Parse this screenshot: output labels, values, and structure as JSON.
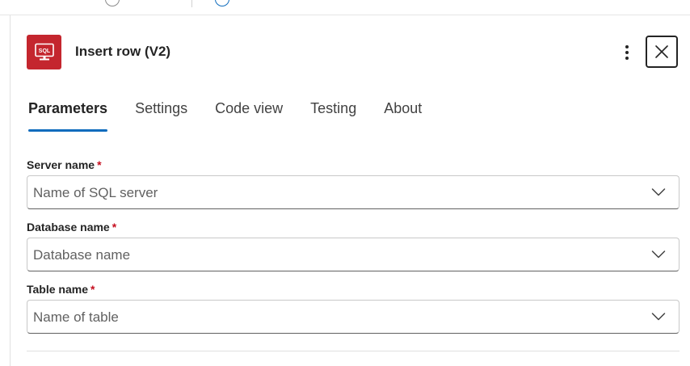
{
  "header": {
    "title": "Insert row (V2)",
    "icon_label": "SQL",
    "icon_color": "#c4262e"
  },
  "tabs": [
    {
      "label": "Parameters",
      "active": true
    },
    {
      "label": "Settings",
      "active": false
    },
    {
      "label": "Code view",
      "active": false
    },
    {
      "label": "Testing",
      "active": false
    },
    {
      "label": "About",
      "active": false
    }
  ],
  "fields": [
    {
      "label": "Server name",
      "required_mark": "*",
      "placeholder": "Name of SQL server"
    },
    {
      "label": "Database name",
      "required_mark": "*",
      "placeholder": "Database name"
    },
    {
      "label": "Table name",
      "required_mark": "*",
      "placeholder": "Name of table"
    }
  ],
  "colors": {
    "accent": "#0f6cbd",
    "required": "#c50f1f"
  }
}
